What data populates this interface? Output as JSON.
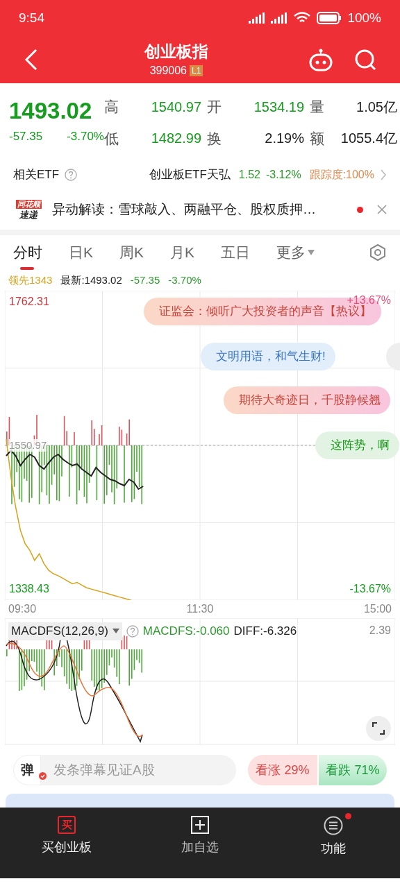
{
  "status_bar": {
    "time": "9:54",
    "battery": "100%"
  },
  "header": {
    "title": "创业板指",
    "code": "399006",
    "level_badge": "L1"
  },
  "quote": {
    "price": "1493.02",
    "change": "-57.35",
    "change_pct": "-3.70%",
    "stats": [
      {
        "label": "高",
        "value": "1540.97",
        "color": "#169c1e"
      },
      {
        "label": "开",
        "value": "1534.19",
        "color": "#169c1e"
      },
      {
        "label": "量",
        "value": "1.05亿",
        "color": "#222222"
      },
      {
        "label": "低",
        "value": "1482.99",
        "color": "#169c1e"
      },
      {
        "label": "换",
        "value": "2.19%",
        "color": "#222222"
      },
      {
        "label": "额",
        "value": "1055.4亿",
        "color": "#222222"
      }
    ]
  },
  "etf": {
    "label": "相关ETF",
    "name": "创业板ETF天弘",
    "price": "1.52",
    "change_pct": "-3.12%",
    "tracking": "跟踪度:100%"
  },
  "news": {
    "logo_top": "同花顺",
    "logo_bottom": "速递",
    "text": "异动解读：雪球敲入、两融平仓、股权质押…",
    "unread": true
  },
  "tabs": [
    {
      "label": "分时",
      "selected": true
    },
    {
      "label": "日K",
      "selected": false
    },
    {
      "label": "周K",
      "selected": false
    },
    {
      "label": "月K",
      "selected": false
    },
    {
      "label": "五日",
      "selected": false
    },
    {
      "label": "更多",
      "selected": false,
      "dropdown": true
    }
  ],
  "info_line": {
    "lead": "领先1343",
    "latest": "最新:1493.02",
    "change": "-57.35",
    "change_pct": "-3.70%"
  },
  "price_chart": {
    "top_label": "1762.31",
    "base_label": "1550.97",
    "bottom_label": "1338.43",
    "top_pct": "+13.67%",
    "bottom_pct": "-13.67%"
  },
  "danmaku": [
    {
      "text": "证监会：倾听广大投资者的声音【热议】",
      "kind": "hot"
    },
    {
      "text": "文明用语，和气生财!",
      "kind": "blue"
    },
    {
      "text": "期待大奇迹日，千股静候翘",
      "kind": "hot"
    },
    {
      "text": "这阵势，啊",
      "kind": "green"
    }
  ],
  "x_labels": [
    "09:30",
    "11:30",
    "15:00"
  ],
  "macd": {
    "selector": "MACDFS(12,26,9)",
    "macdfs": "MACDFS:-0.060",
    "diff": "DIFF:-6.326",
    "top_value": "2.39"
  },
  "comment_bar": {
    "icon_char": "弹",
    "placeholder": "发条弹幕见证A股",
    "bull": "看涨 29%",
    "bear": "看跌 71%"
  },
  "bottom_nav": [
    {
      "icon_char": "买",
      "label": "买创业板",
      "kind": "buy"
    },
    {
      "label": "加自选",
      "kind": "add"
    },
    {
      "label": "功能",
      "kind": "menu",
      "badge": true
    }
  ]
}
